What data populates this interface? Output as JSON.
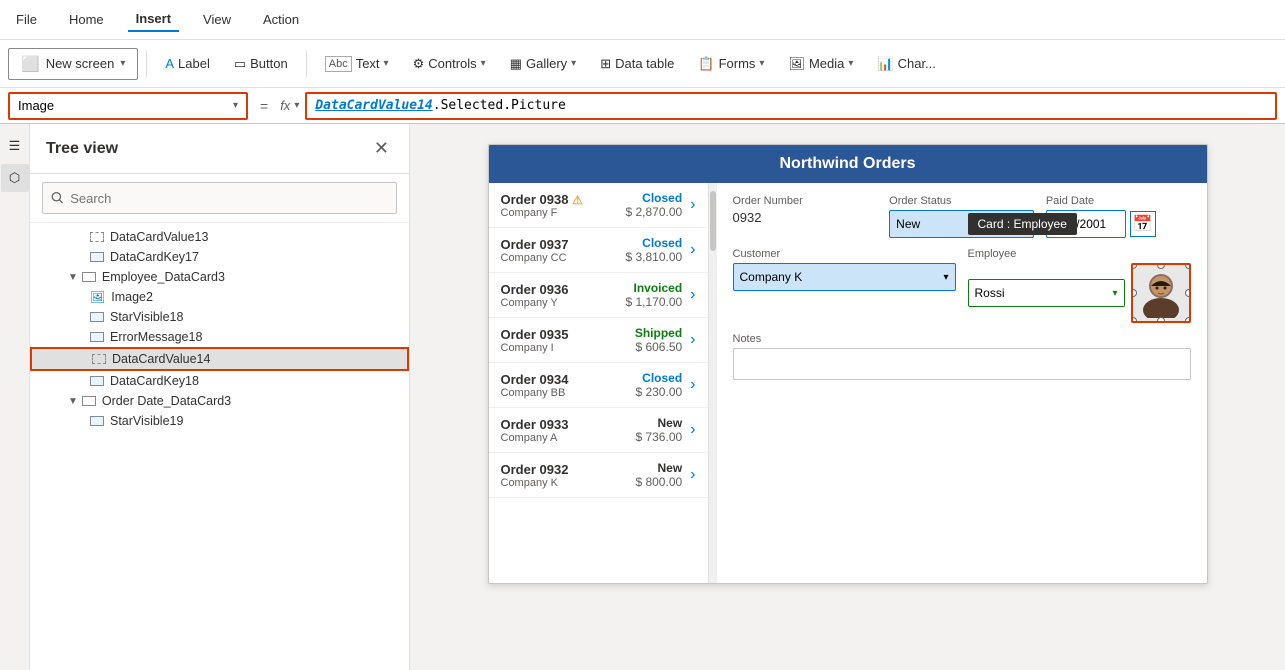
{
  "menubar": {
    "items": [
      {
        "id": "file",
        "label": "File",
        "active": false
      },
      {
        "id": "home",
        "label": "Home",
        "active": false
      },
      {
        "id": "insert",
        "label": "Insert",
        "active": true
      },
      {
        "id": "view",
        "label": "View",
        "active": false
      },
      {
        "id": "action",
        "label": "Action",
        "active": false
      }
    ]
  },
  "toolbar": {
    "new_screen_label": "New screen",
    "label_label": "Label",
    "button_label": "Button",
    "text_label": "Text",
    "controls_label": "Controls",
    "gallery_label": "Gallery",
    "data_table_label": "Data table",
    "forms_label": "Forms",
    "media_label": "Media",
    "charts_label": "Char..."
  },
  "formula_bar": {
    "name_box_value": "Image",
    "fx_label": "fx",
    "formula_keyword": "DataCardValue14",
    "formula_rest": ".Selected.Picture"
  },
  "tree_panel": {
    "title": "Tree view",
    "search_placeholder": "Search",
    "items": [
      {
        "id": "datacardvalue13",
        "label": "DataCardValue13",
        "indent": 3,
        "icon": "dashed-rect",
        "type": "leaf"
      },
      {
        "id": "datacardkey17",
        "label": "DataCardKey17",
        "indent": 3,
        "icon": "edit-rect",
        "type": "leaf"
      },
      {
        "id": "employee-datacard3",
        "label": "Employee_DataCard3",
        "indent": 2,
        "icon": "rect",
        "type": "parent",
        "expanded": true
      },
      {
        "id": "image2",
        "label": "Image2",
        "indent": 3,
        "icon": "image",
        "type": "leaf"
      },
      {
        "id": "starvisible18",
        "label": "StarVisible18",
        "indent": 3,
        "icon": "edit-rect",
        "type": "leaf"
      },
      {
        "id": "errormessage18",
        "label": "ErrorMessage18",
        "indent": 3,
        "icon": "edit-rect",
        "type": "leaf"
      },
      {
        "id": "datacardvalue14",
        "label": "DataCardValue14",
        "indent": 3,
        "icon": "dashed-rect",
        "type": "leaf",
        "selected": true
      },
      {
        "id": "datacardkey18",
        "label": "DataCardKey18",
        "indent": 3,
        "icon": "edit-rect",
        "type": "leaf"
      },
      {
        "id": "orderdate-datacard3",
        "label": "Order Date_DataCard3",
        "indent": 2,
        "icon": "rect",
        "type": "parent",
        "expanded": true
      },
      {
        "id": "starvisible19",
        "label": "StarVisible19",
        "indent": 3,
        "icon": "edit-rect",
        "type": "leaf"
      }
    ]
  },
  "app": {
    "title": "Northwind Orders",
    "orders": [
      {
        "num": "Order 0938",
        "company": "Company F",
        "status": "Closed",
        "status_type": "closed",
        "amount": "$ 2,870.00",
        "warning": true
      },
      {
        "num": "Order 0937",
        "company": "Company CC",
        "status": "Closed",
        "status_type": "closed",
        "amount": "$ 3,810.00",
        "warning": false
      },
      {
        "num": "Order 0936",
        "company": "Company Y",
        "status": "Invoiced",
        "status_type": "invoiced",
        "amount": "$ 1,170.00",
        "warning": false
      },
      {
        "num": "Order 0935",
        "company": "Company I",
        "status": "Shipped",
        "status_type": "shipped",
        "amount": "$ 606.50",
        "warning": false
      },
      {
        "num": "Order 0934",
        "company": "Company BB",
        "status": "Closed",
        "status_type": "closed",
        "amount": "$ 230.00",
        "warning": false
      },
      {
        "num": "Order 0933",
        "company": "Company A",
        "status": "New",
        "status_type": "new",
        "amount": "$ 736.00",
        "warning": false
      },
      {
        "num": "Order 0932",
        "company": "Company K",
        "status": "New",
        "status_type": "new",
        "amount": "$ 800.00",
        "warning": false
      }
    ],
    "detail": {
      "order_number_label": "Order Number",
      "order_number_value": "0932",
      "order_status_label": "Order Status",
      "order_status_value": "New",
      "paid_date_label": "Paid Date",
      "paid_date_value": "2/31/2001",
      "customer_label": "Customer",
      "customer_value": "Company K",
      "employee_label": "Employee",
      "employee_value": "Rossi",
      "notes_label": "Notes",
      "notes_value": "",
      "card_tooltip": "Card : Employee"
    }
  }
}
